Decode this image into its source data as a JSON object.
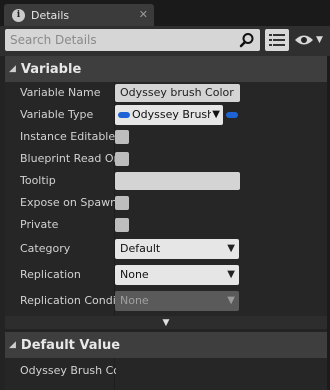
{
  "tab": {
    "title": "Details",
    "icon": "info-icon",
    "close_glyph": "✕"
  },
  "search": {
    "placeholder": "Search Details",
    "value": ""
  },
  "sections": {
    "variable": {
      "title": "Variable",
      "expanded": true
    },
    "default_value": {
      "title": "Default Value",
      "expanded": true
    }
  },
  "variable": {
    "name_label": "Variable Name",
    "name_value": "Odyssey brush Color",
    "type_label": "Variable Type",
    "type_value": "Odyssey Brush",
    "type_pill_color": "#1e63d6",
    "instance_editable_label": "Instance Editable",
    "instance_editable_checked": false,
    "bp_readonly_label": "Blueprint Read Only",
    "bp_readonly_checked": false,
    "tooltip_label": "Tooltip",
    "tooltip_value": "",
    "expose_label": "Expose on Spawn",
    "expose_checked": false,
    "private_label": "Private",
    "private_checked": false,
    "category_label": "Category",
    "category_value": "Default",
    "replication_label": "Replication",
    "replication_value": "None",
    "rep_condition_label": "Replication Condition",
    "rep_condition_value": "None"
  },
  "default_value": {
    "row_label": "Odyssey Brush Color"
  },
  "advanced_glyph": "▼",
  "icons": [
    "info-icon",
    "close-icon",
    "search-icon",
    "list-view-icon",
    "eye-icon",
    "dropdown-arrow-icon"
  ]
}
